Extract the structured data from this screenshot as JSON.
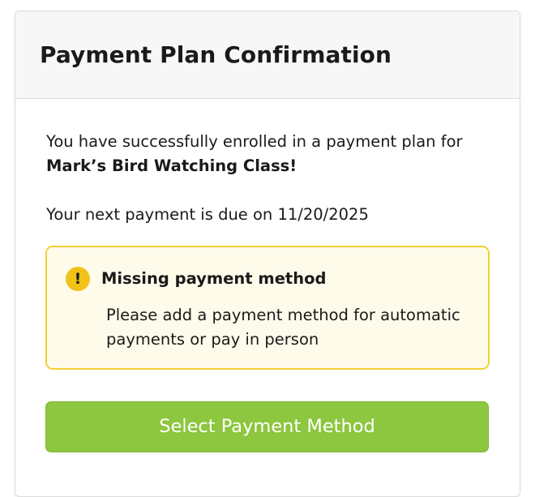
{
  "header": {
    "title": "Payment Plan Confirmation"
  },
  "body": {
    "intro_text": "You have successfully enrolled in a payment plan for",
    "class_name": "Mark’s Bird Watching Class!",
    "due_text": "Your next payment is due on 11/20/2025"
  },
  "alert": {
    "icon": "exclamation-icon",
    "icon_glyph": "!",
    "title": "Missing payment method",
    "message": "Please add a payment method for automatic payments or pay in person"
  },
  "actions": {
    "primary_label": "Select Payment Method"
  },
  "colors": {
    "button": "#8dc63f",
    "alert_border": "#f2cf39",
    "alert_background": "#fffbea",
    "alert_icon": "#f2c317",
    "header_background": "#f7f7f7"
  }
}
